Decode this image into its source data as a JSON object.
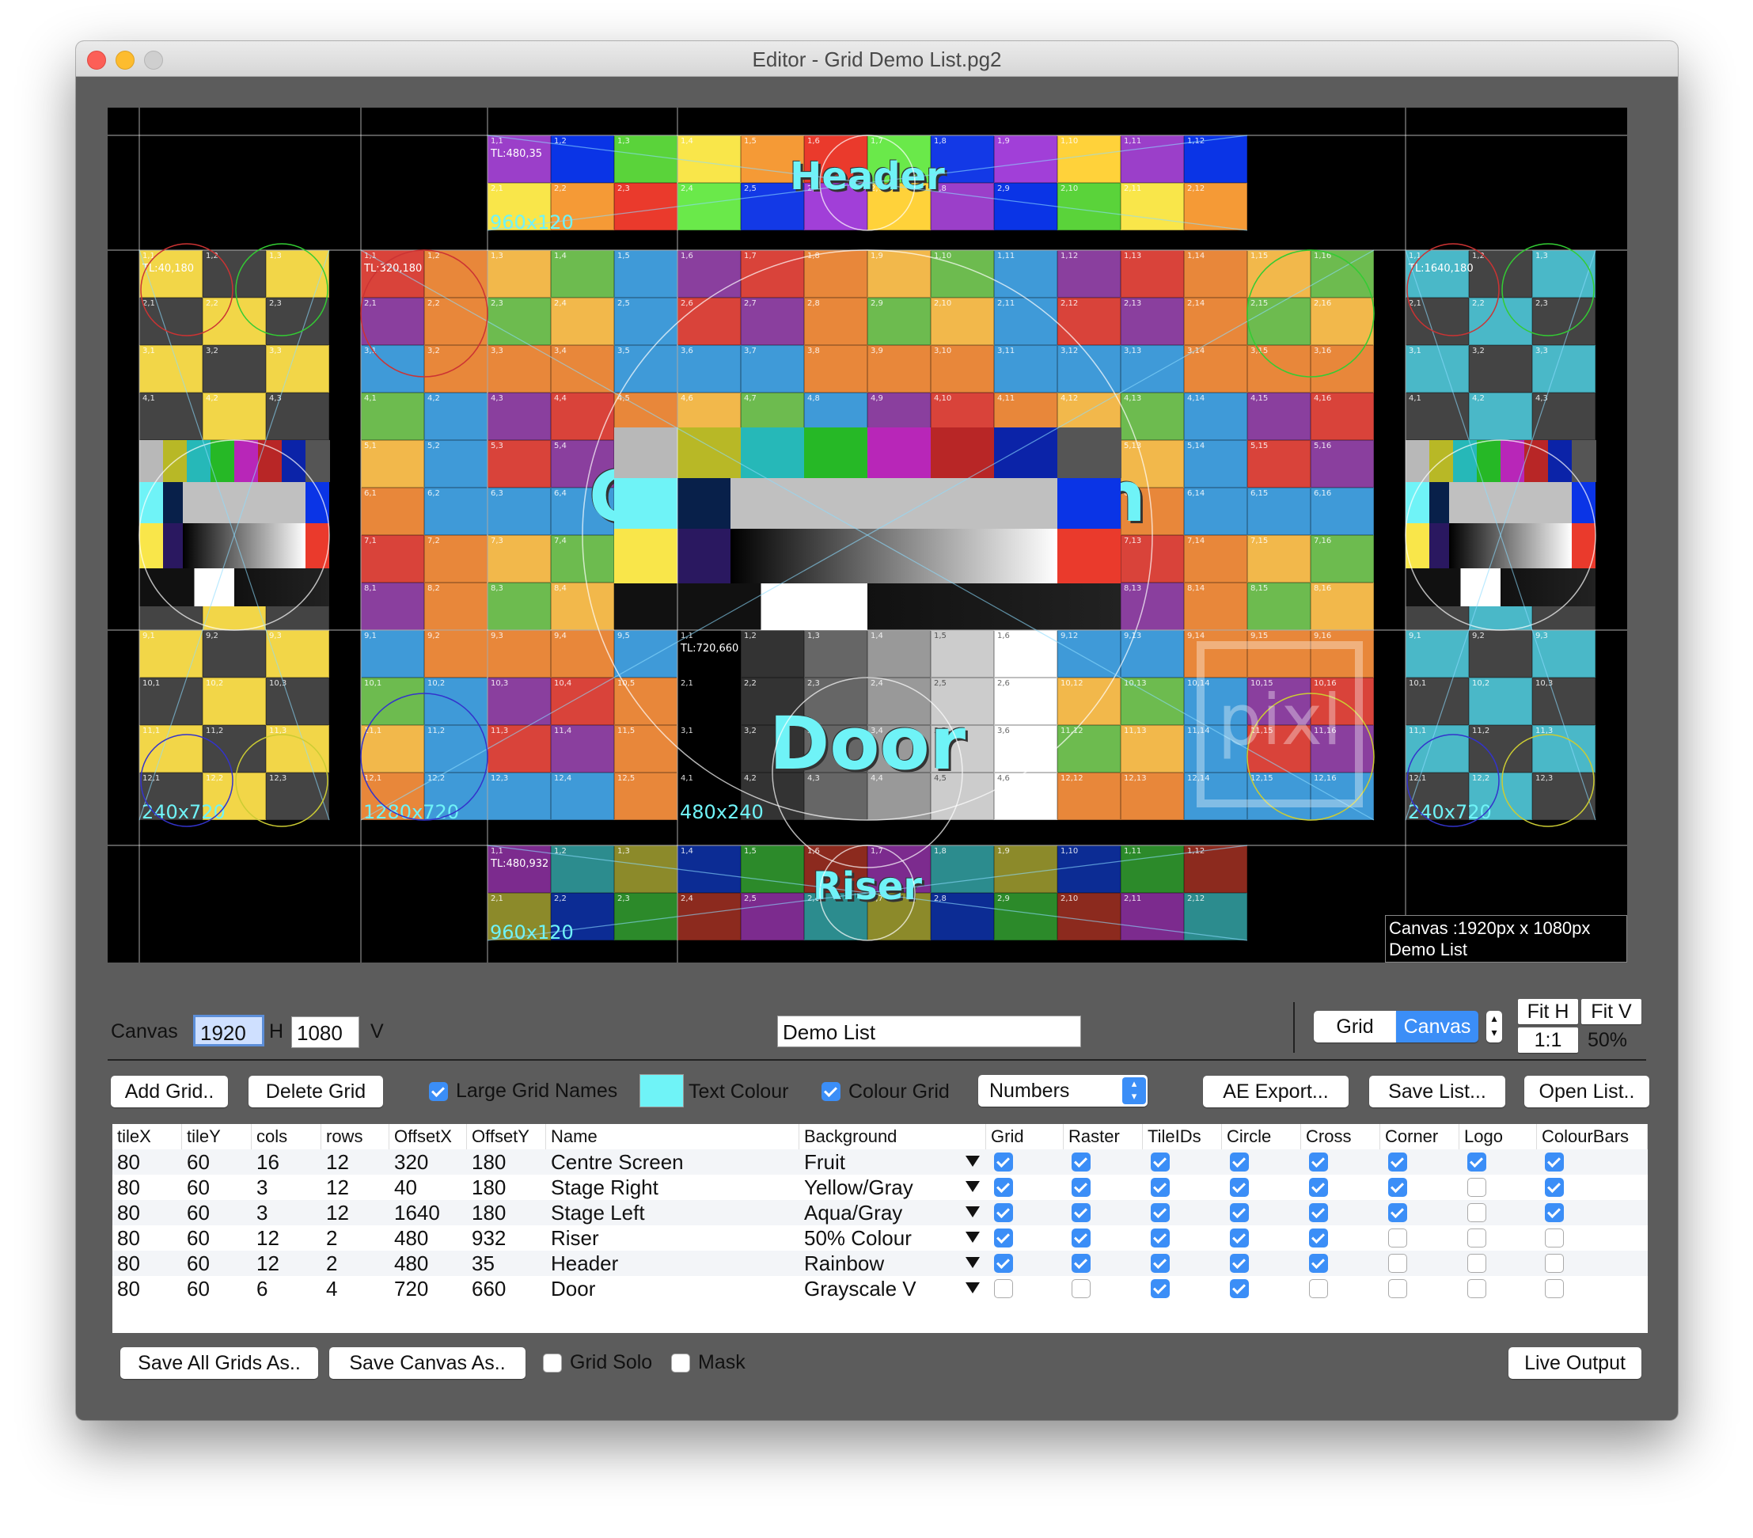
{
  "window": {
    "title": "Editor - Grid Demo List.pg2"
  },
  "grids": [
    {
      "label": "Header",
      "tl": "TL:480,35",
      "size": "960x120",
      "cols": 12,
      "rows": 2,
      "ox": 480,
      "oy": 35,
      "pattern": "rainbow"
    },
    {
      "label": "Stage Right",
      "tl": "TL:40,180",
      "size": "240x720",
      "cols": 3,
      "rows": 12,
      "ox": 40,
      "oy": 180,
      "pattern": "yellowgray"
    },
    {
      "label": "Centre Screen",
      "tl": "TL:320,180",
      "size": "1280x720",
      "cols": 16,
      "rows": 12,
      "ox": 320,
      "oy": 180,
      "pattern": "fruit"
    },
    {
      "label": "Stage Left",
      "tl": "TL:1640,180",
      "size": "240x720",
      "cols": 3,
      "rows": 12,
      "ox": 1640,
      "oy": 180,
      "pattern": "aquagray"
    },
    {
      "label": "Riser",
      "tl": "TL:480,932",
      "size": "960x120",
      "cols": 12,
      "rows": 2,
      "ox": 480,
      "oy": 932,
      "pattern": "fifty"
    },
    {
      "label": "Door",
      "tl": "TL:720,660",
      "size": "480x240",
      "cols": 6,
      "rows": 4,
      "ox": 720,
      "oy": 660,
      "pattern": "grayscale"
    }
  ],
  "canvas_info": {
    "line1": "Canvas :1920px x 1080px",
    "line2": "Demo List"
  },
  "logo_text": "pixl",
  "controls": {
    "canvas_label": "Canvas",
    "width": "1920",
    "h_label": "H",
    "height": "1080",
    "v_label": "V",
    "list_name": "Demo List",
    "seg_grid": "Grid",
    "seg_canvas": "Canvas",
    "fit_h": "Fit H",
    "fit_v": "Fit V",
    "one_to_one": "1:1",
    "zoom": "50%"
  },
  "toolbar": {
    "add_grid": "Add Grid..",
    "delete_grid": "Delete Grid",
    "large_grid_names": "Large Grid Names",
    "text_colour": "Text Colour",
    "text_colour_value": "#6ff3f7",
    "colour_grid": "Colour Grid",
    "numbers": "Numbers",
    "ae_export": "AE Export...",
    "save_list": "Save List...",
    "open_list": "Open List.."
  },
  "table": {
    "headers": [
      "tileX",
      "tileY",
      "cols",
      "rows",
      "OffsetX",
      "OffsetY",
      "Name",
      "Background",
      "Grid",
      "Raster",
      "TileIDs",
      "Circle",
      "Cross",
      "Corner",
      "Logo",
      "ColourBars"
    ],
    "rows": [
      {
        "tileX": "80",
        "tileY": "60",
        "cols": "16",
        "rows": "12",
        "offsetX": "320",
        "offsetY": "180",
        "name": "Centre Screen",
        "background": "Fruit",
        "checks": [
          true,
          true,
          true,
          true,
          true,
          true,
          true,
          true
        ]
      },
      {
        "tileX": "80",
        "tileY": "60",
        "cols": "3",
        "rows": "12",
        "offsetX": "40",
        "offsetY": "180",
        "name": "Stage Right",
        "background": "Yellow/Gray",
        "checks": [
          true,
          true,
          true,
          true,
          true,
          true,
          false,
          true
        ]
      },
      {
        "tileX": "80",
        "tileY": "60",
        "cols": "3",
        "rows": "12",
        "offsetX": "1640",
        "offsetY": "180",
        "name": "Stage Left",
        "background": "Aqua/Gray",
        "checks": [
          true,
          true,
          true,
          true,
          true,
          true,
          false,
          true
        ]
      },
      {
        "tileX": "80",
        "tileY": "60",
        "cols": "12",
        "rows": "2",
        "offsetX": "480",
        "offsetY": "932",
        "name": "Riser",
        "background": "50% Colour",
        "checks": [
          true,
          true,
          true,
          true,
          true,
          false,
          false,
          false
        ]
      },
      {
        "tileX": "80",
        "tileY": "60",
        "cols": "12",
        "rows": "2",
        "offsetX": "480",
        "offsetY": "35",
        "name": "Header",
        "background": "Rainbow",
        "checks": [
          true,
          true,
          true,
          true,
          true,
          false,
          false,
          false
        ]
      },
      {
        "tileX": "80",
        "tileY": "60",
        "cols": "6",
        "rows": "4",
        "offsetX": "720",
        "offsetY": "660",
        "name": "Door",
        "background": "Grayscale V",
        "checks": [
          false,
          false,
          true,
          true,
          false,
          false,
          false,
          false
        ]
      }
    ]
  },
  "bottom": {
    "save_all": "Save All Grids As..",
    "save_canvas": "Save Canvas As..",
    "grid_solo": "Grid Solo",
    "mask": "Mask",
    "live_output": "Live Output"
  },
  "colors": {
    "accent": "#3b8ef7",
    "name_text": "#6ff3f7",
    "window_bg": "#5c5c5c"
  }
}
